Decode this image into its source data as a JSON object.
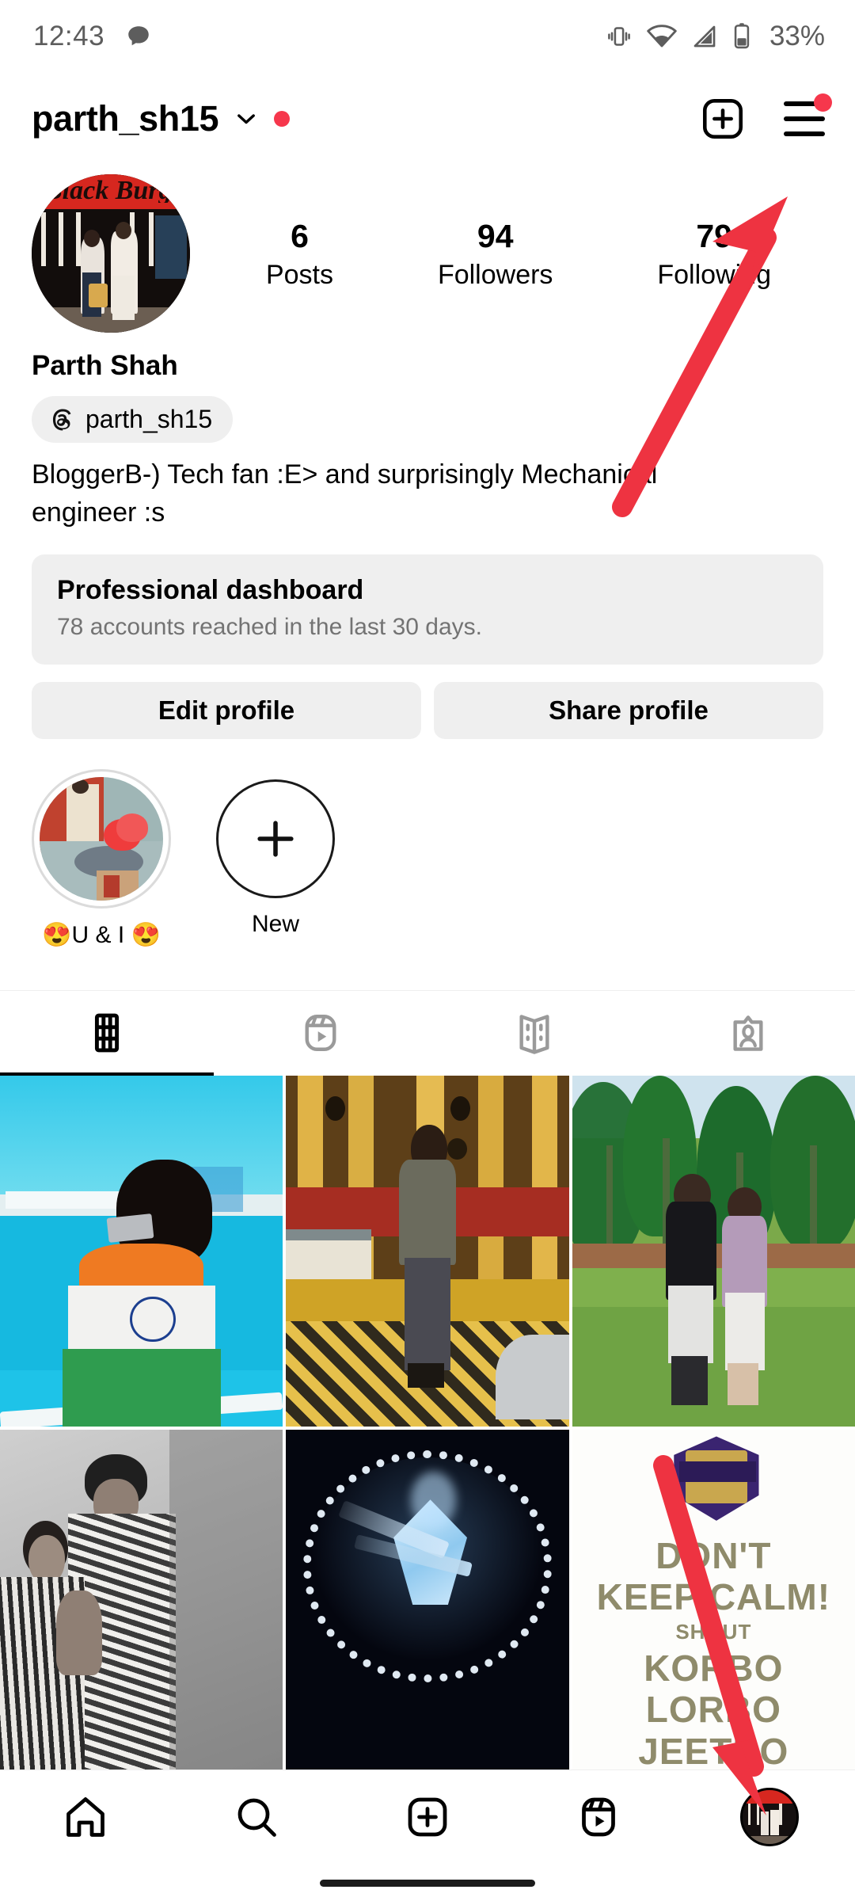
{
  "status_bar": {
    "time": "12:43",
    "battery_percent": "33%",
    "icons": [
      "chat-bubble-icon",
      "vibrate-icon",
      "wifi-icon",
      "cellular-signal-icon",
      "battery-icon"
    ]
  },
  "app_bar": {
    "username": "parth_sh15",
    "has_account_switcher": true,
    "has_notification_dot": true,
    "create_label": "create-post",
    "menu_label": "menu",
    "menu_has_badge": true
  },
  "profile": {
    "avatar_alt": "profile-picture",
    "full_name": "Parth Shah",
    "threads_handle": "parth_sh15",
    "bio": "BloggerB-) Tech fan :E> and surprisingly Mechanical engineer :s",
    "stats": [
      {
        "value": "6",
        "label": "Posts"
      },
      {
        "value": "79",
        "label": "Following_placeholder"
      },
      {
        "value": "94",
        "label": "Followers"
      }
    ],
    "stats_ordered": [
      {
        "value": "6",
        "label": "Posts"
      },
      {
        "value": "94",
        "label": "Followers"
      },
      {
        "value": "79",
        "label": "Following"
      }
    ]
  },
  "dashboard": {
    "title": "Professional dashboard",
    "subtitle": "78 accounts reached in the last 30 days."
  },
  "buttons": {
    "edit_profile": "Edit profile",
    "share_profile": "Share profile"
  },
  "highlights": [
    {
      "label": "😍U & I 😍",
      "type": "story-highlight"
    },
    {
      "label": "New",
      "type": "new-highlight"
    }
  ],
  "tabs": [
    {
      "name": "grid-tab",
      "icon": "grid-icon",
      "active": true
    },
    {
      "name": "reels-tab",
      "icon": "reels-icon",
      "active": false
    },
    {
      "name": "guides-tab",
      "icon": "guides-icon",
      "active": false
    },
    {
      "name": "tagged-tab",
      "icon": "tagged-person-icon",
      "active": false
    }
  ],
  "grid_posts": [
    {
      "id": "post-1",
      "alt": "Person draped in Indian flag by the sea"
    },
    {
      "id": "post-2",
      "alt": "Man standing in ornate golden hall"
    },
    {
      "id": "post-3",
      "alt": "Couple on lawn with palm trees"
    },
    {
      "id": "post-4",
      "alt": "Black and white couple portrait"
    },
    {
      "id": "post-5",
      "alt": "Diamond under ring light"
    },
    {
      "id": "post-6",
      "alt": "Kolkata Knight Riders poster",
      "overlay_text": [
        "DON'T",
        "KEEP CALM!",
        "SHOUT",
        "KORBO LORBO",
        "JEETBO"
      ]
    }
  ],
  "bottom_nav": [
    {
      "name": "home-tab",
      "icon": "home-icon"
    },
    {
      "name": "search-tab",
      "icon": "search-icon"
    },
    {
      "name": "create-tab",
      "icon": "plus-square-icon"
    },
    {
      "name": "reels-tab",
      "icon": "reels-icon"
    },
    {
      "name": "profile-tab",
      "icon": "avatar-icon",
      "active": true
    }
  ],
  "annotations": [
    {
      "name": "arrow-to-menu",
      "color": "#ee3341",
      "points_to": "menu-button"
    },
    {
      "name": "arrow-to-profile-tab",
      "color": "#ee3341",
      "points_to": "profile-tab"
    }
  ],
  "colors": {
    "accent_red": "#f6374c",
    "arrow_red": "#ee3341",
    "surface_grey": "#efefef",
    "muted_text": "#737373",
    "status_icon": "#5d5d5d"
  }
}
